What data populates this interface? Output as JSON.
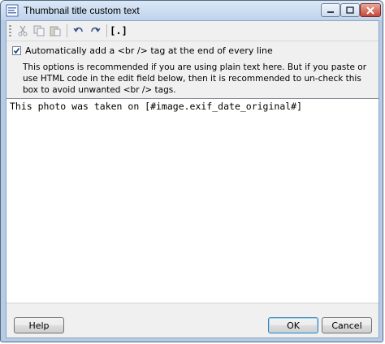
{
  "window": {
    "title": "Thumbnail title custom text"
  },
  "toolbar": {
    "icons": [
      "cut-icon",
      "copy-icon",
      "paste-icon",
      "undo-icon",
      "redo-icon",
      "code-brackets-icon"
    ],
    "code_label": "[.]"
  },
  "option": {
    "checked": true,
    "label": "Automatically add a <br /> tag at the end of every line"
  },
  "notice": {
    "text": "This options is recommended if you are using plain text here. But if you paste or use HTML code in the edit field below, then it is recommended to un-check this box to avoid unwanted <br /> tags."
  },
  "editor": {
    "value": "This photo was taken on [#image.exif_date_original#]"
  },
  "buttons": {
    "help": "Help",
    "ok": "OK",
    "cancel": "Cancel"
  }
}
